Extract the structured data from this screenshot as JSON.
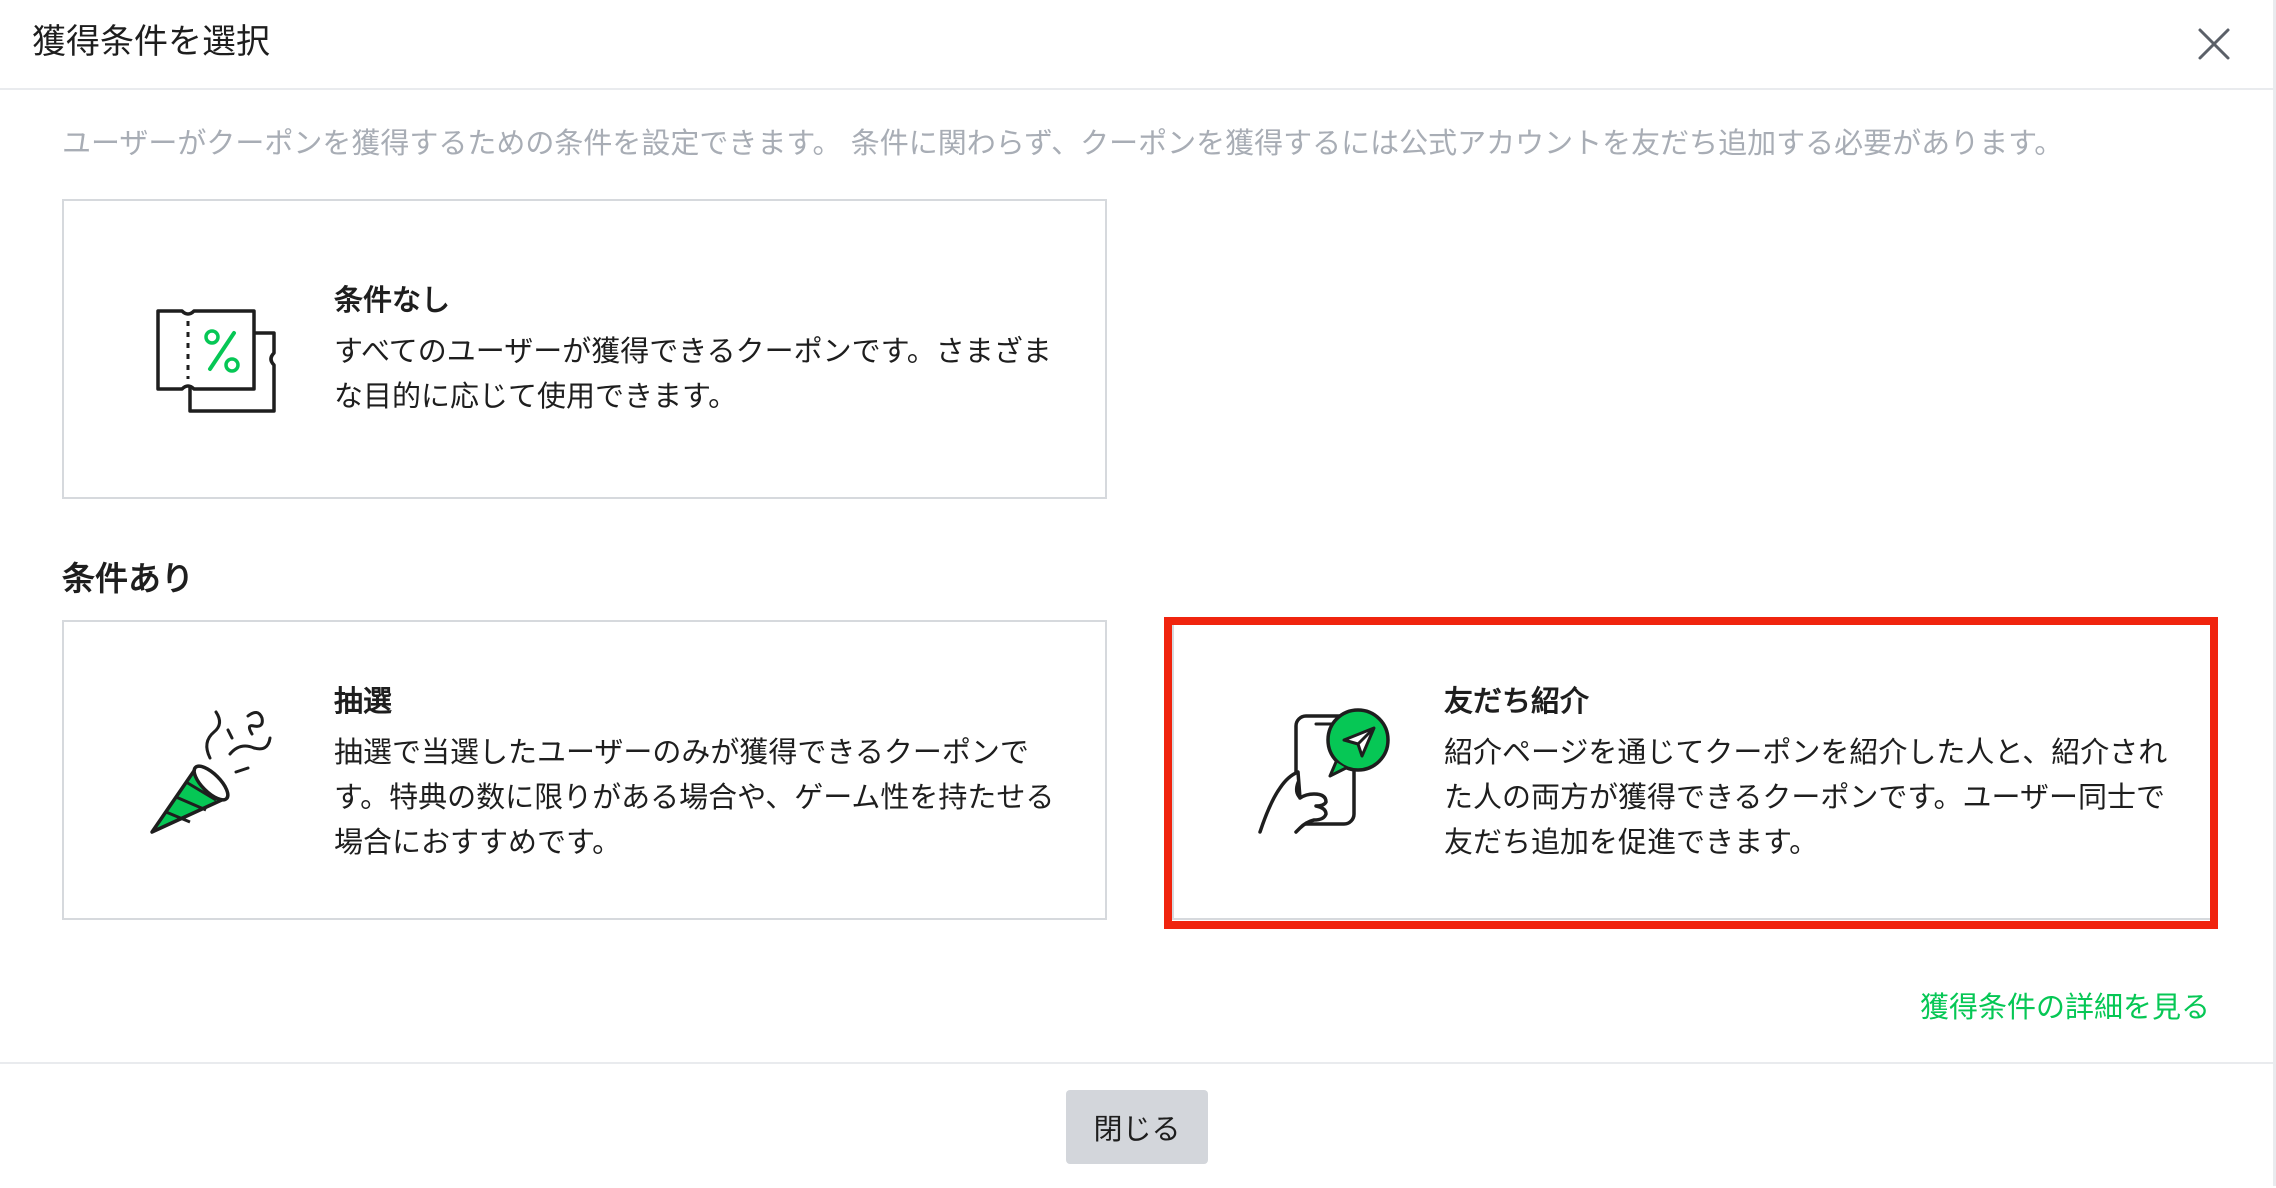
{
  "header": {
    "title": "獲得条件を選択",
    "close_icon": "close-icon"
  },
  "description": "ユーザーがクーポンを獲得するための条件を設定できます。 条件に関わらず、クーポンを獲得するには公式アカウントを友だち追加する必要があります。",
  "options": {
    "no_condition": {
      "title": "条件なし",
      "description": "すべてのユーザーが獲得できるクーポンです。さまざまな目的に応じて使用できます。",
      "icon": "coupon-percent-icon"
    },
    "section_label": "条件あり",
    "lottery": {
      "title": "抽選",
      "description": "抽選で当選したユーザーのみが獲得できるクーポンです。特典の数に限りがある場合や、ゲーム性を持たせる場合におすすめです。",
      "icon": "party-popper-icon"
    },
    "friend_referral": {
      "title": "友だち紹介",
      "description": "紹介ページを通じてクーポンを紹介した人と、紹介された人の両方が獲得できるクーポンです。ユーザー同士で友だち追加を促進できます。",
      "icon": "phone-send-icon",
      "highlighted": true
    }
  },
  "details_link": "獲得条件の詳細を見る",
  "footer": {
    "close_label": "閉じる"
  },
  "colors": {
    "accent_green": "#06c755",
    "highlight_red": "#f0240e",
    "muted_text": "#a8adb5",
    "button_gray": "#d3d6db"
  }
}
